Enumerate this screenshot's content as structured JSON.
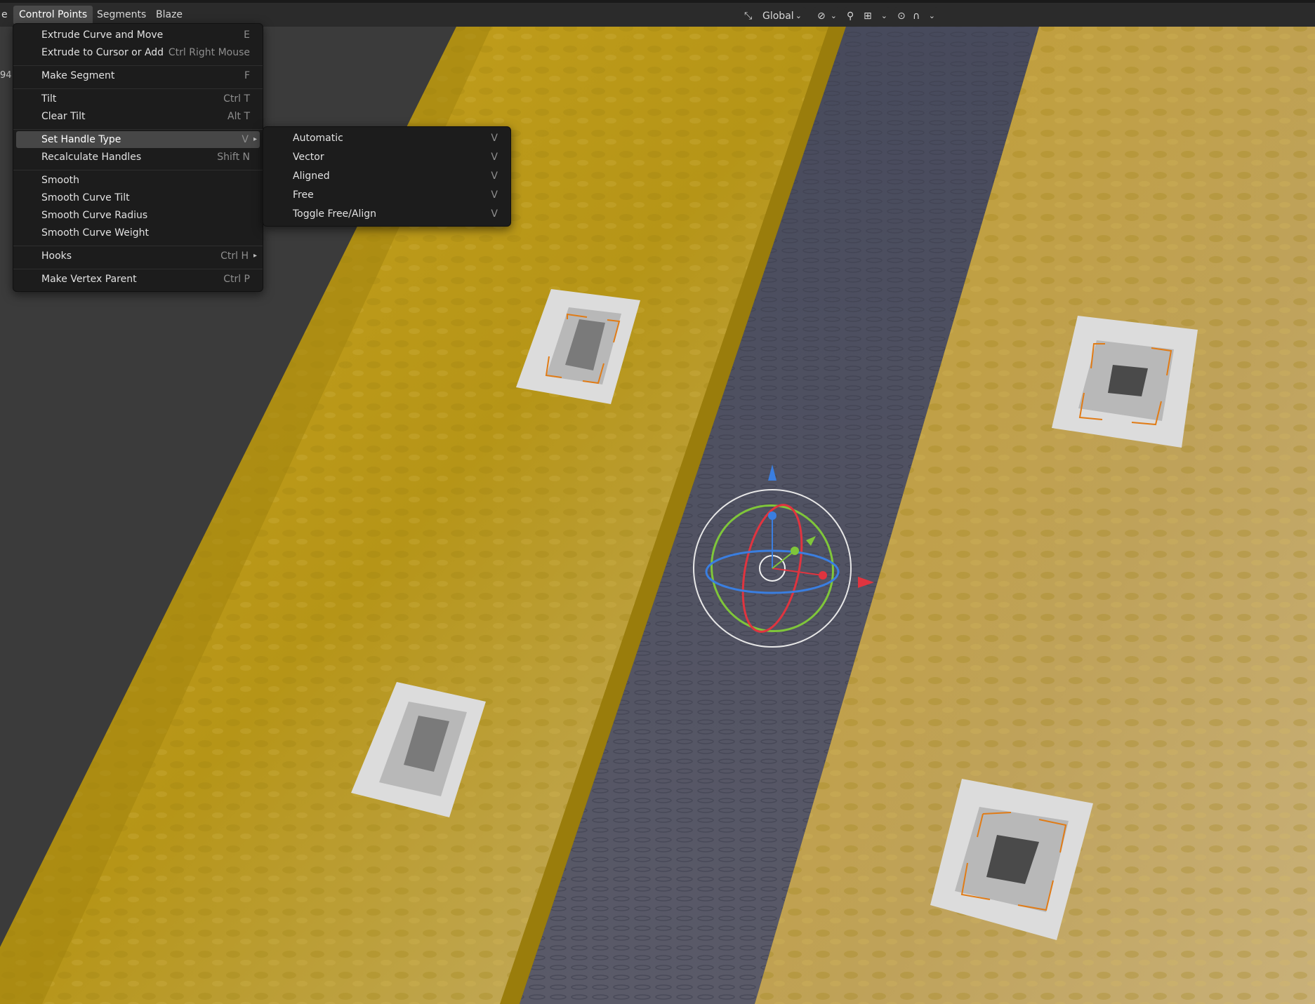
{
  "header": {
    "left_clip": "e",
    "menus": [
      "Control Points",
      "Segments",
      "Blaze"
    ],
    "orientation": "Global",
    "side_clip": "94"
  },
  "control_points_menu": {
    "items": [
      {
        "label": "Extrude Curve and Move",
        "shortcut": "E"
      },
      {
        "label": "Extrude to Cursor or Add",
        "shortcut": "Ctrl Right Mouse"
      },
      {
        "label": "Make Segment",
        "shortcut": "F"
      },
      {
        "label": "Tilt",
        "shortcut": "Ctrl T"
      },
      {
        "label": "Clear Tilt",
        "shortcut": "Alt T"
      },
      {
        "label": "Set Handle Type",
        "shortcut": "V"
      },
      {
        "label": "Recalculate Handles",
        "shortcut": "Shift N"
      },
      {
        "label": "Smooth",
        "shortcut": ""
      },
      {
        "label": "Smooth Curve Tilt",
        "shortcut": ""
      },
      {
        "label": "Smooth Curve Radius",
        "shortcut": ""
      },
      {
        "label": "Smooth Curve Weight",
        "shortcut": ""
      },
      {
        "label": "Hooks",
        "shortcut": "Ctrl H"
      },
      {
        "label": "Make Vertex Parent",
        "shortcut": "Ctrl P"
      }
    ]
  },
  "handle_type_submenu": {
    "items": [
      {
        "label": "Automatic",
        "shortcut": "V"
      },
      {
        "label": "Vector",
        "shortcut": "V"
      },
      {
        "label": "Aligned",
        "shortcut": "V"
      },
      {
        "label": "Free",
        "shortcut": "V"
      },
      {
        "label": "Toggle Free/Align",
        "shortcut": "V"
      }
    ]
  },
  "colors": {
    "yellow_surface": "#b8961a",
    "water": "#55566a",
    "menu_bg": "#1c1c1c",
    "highlight": "#474747",
    "gizmo_x": "#e0343f",
    "gizmo_y": "#7fc63a",
    "gizmo_z": "#3a7ee0"
  }
}
